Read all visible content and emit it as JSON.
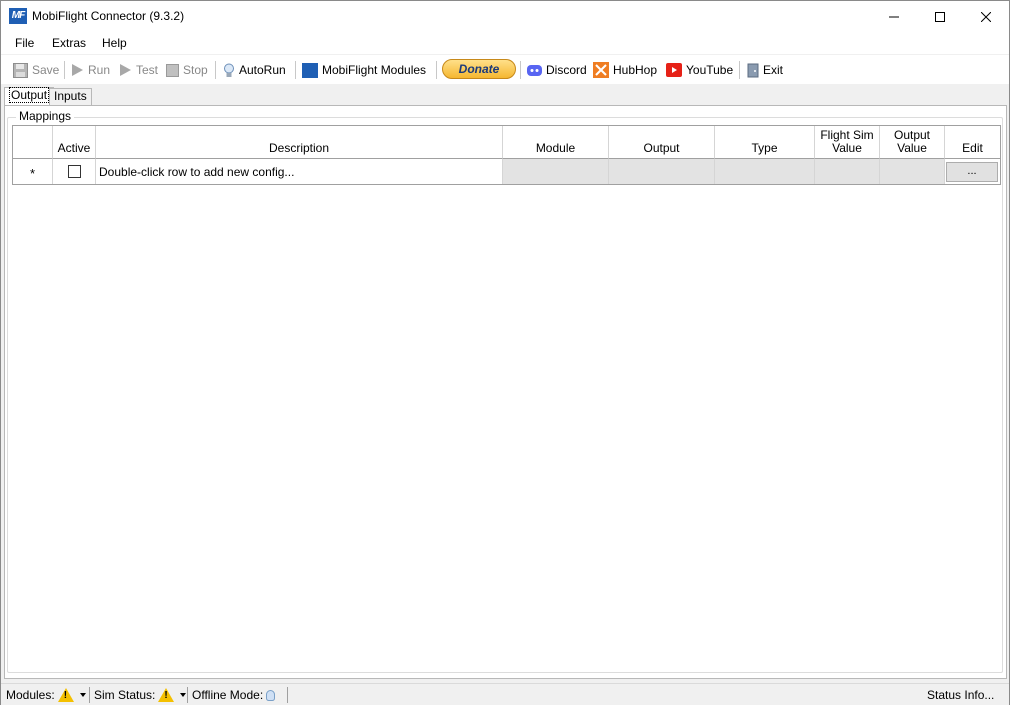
{
  "window": {
    "title": "MobiFlight Connector (9.3.2)",
    "logo_text": "MF"
  },
  "menu": {
    "items": [
      "File",
      "Extras",
      "Help"
    ]
  },
  "toolbar": {
    "save": "Save",
    "run": "Run",
    "test": "Test",
    "stop": "Stop",
    "autorun": "AutoRun",
    "modules": "MobiFlight Modules",
    "donate": "Donate",
    "discord": "Discord",
    "hubhop": "HubHop",
    "youtube": "YouTube",
    "exit": "Exit"
  },
  "tabs": {
    "output": "Output",
    "inputs": "Inputs"
  },
  "mappings": {
    "group_label": "Mappings",
    "columns": {
      "active": "Active",
      "description": "Description",
      "module": "Module",
      "output": "Output",
      "type": "Type",
      "flight_sim_value_1": "Flight Sim",
      "flight_sim_value_2": "Value",
      "output_value_1": "Output",
      "output_value_2": "Value",
      "edit": "Edit"
    },
    "new_row": {
      "marker": "*",
      "description": "Double-click row to add new config...",
      "edit_button": "..."
    }
  },
  "status": {
    "modules": "Modules:",
    "sim_status": "Sim Status:",
    "offline_mode": "Offline Mode:",
    "status_info": "Status Info..."
  },
  "colors": {
    "accent_blue": "#1f5fb4",
    "warning_yellow": "#f4c000",
    "youtube_red": "#e62117",
    "discord_blue": "#5865f2",
    "hubhop_orange": "#ef7d22"
  }
}
